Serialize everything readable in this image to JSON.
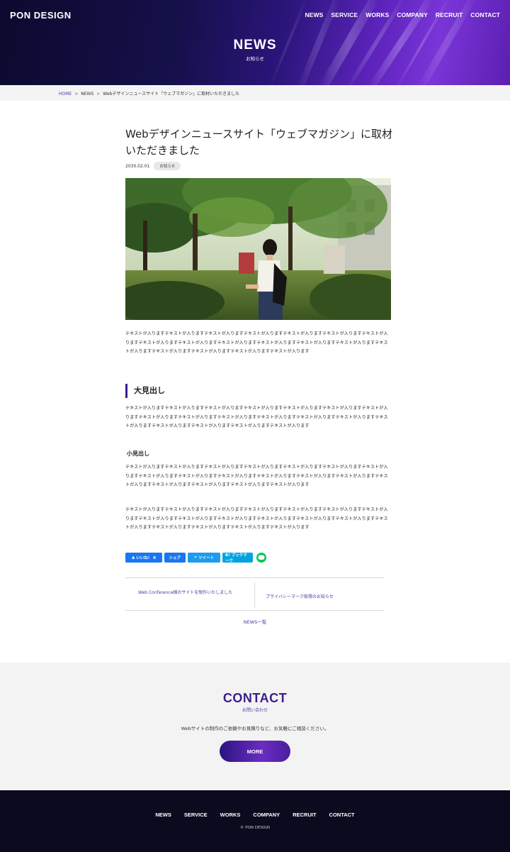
{
  "header": {
    "logo": "PON DESIGN",
    "nav": [
      "NEWS",
      "SERVICE",
      "WORKS",
      "COMPANY",
      "RECRUIT",
      "CONTACT"
    ],
    "title": "NEWS",
    "subtitle": "お知らせ"
  },
  "breadcrumb": {
    "home": "HOME",
    "section": "NEWS",
    "current": "Webデザインニュースサイト「ウェブマガジン」に取材いただきました",
    "separator": ">"
  },
  "article": {
    "title": "Webデザインニュースサイト「ウェブマガジン」に取材いただきました",
    "date": "2030.02.01",
    "category": "お知らせ",
    "intro": "テキストが入りますテキストが入りますテキストが入りますテキストが入りますテキストが入りますテキストが入りますテキストが入りますテキストが入りますテキストが入りますテキストが入りますテキストが入りますテキストが入りますテキストが入りますテキストが入りますテキストが入りますテキストが入りますテキストが入りますテキストが入ります",
    "heading_large": "大見出し",
    "para_1": "テキストが入りますテキストが入りますテキストが入りますテキストが入りますテキストが入りますテキストが入りますテキストが入りますテキストが入りますテキストが入りますテキストが入りますテキストが入りますテキストが入りますテキストが入りますテキストが入りますテキストが入りますテキストが入りますテキストが入りますテキストが入ります",
    "heading_small": "小見出し",
    "para_2": "テキストが入りますテキストが入りますテキストが入りますテキストが入りますテキストが入りますテキストが入りますテキストが入りますテキストが入りますテキストが入りますテキストが入りますテキストが入りますテキストが入りますテキストが入りますテキストが入りますテキストが入りますテキストが入りますテキストが入りますテキストが入ります",
    "para_3": "テキストが入りますテキストが入りますテキストが入りますテキストが入りますテキストが入りますテキストが入りますテキストが入りますテキストが入りますテキストが入りますテキストが入りますテキストが入りますテキストが入りますテキストが入りますテキストが入りますテキストが入りますテキストが入りますテキストが入りますテキストが入ります"
  },
  "share": {
    "like": "いいね！ 0",
    "share": "シェア",
    "tweet": "ツイート",
    "bookmark": "B! ブックマーク",
    "icons": [
      "facebook-icon",
      "twitter-icon",
      "hatena-icon",
      "line-icon"
    ]
  },
  "pager": {
    "prev": "Web Conference様のサイトを制作いたしました",
    "next": "プライバシーマーク取得のお知らせ",
    "list": "NEWS一覧"
  },
  "contact": {
    "title": "CONTACT",
    "subtitle": "お問い合わせ",
    "text": "Webサイトの制作のご依頼やお見積りなど、お気軽にご相談ください。",
    "button": "MORE"
  },
  "footer": {
    "nav": [
      "NEWS",
      "SERVICE",
      "WORKS",
      "COMPANY",
      "RECRUIT",
      "CONTACT"
    ],
    "copyright": "© PON DESIGN"
  },
  "colors": {
    "accent": "#3b1e8c",
    "link": "#4b3aa8",
    "footer_bg": "#0c0a1e"
  }
}
